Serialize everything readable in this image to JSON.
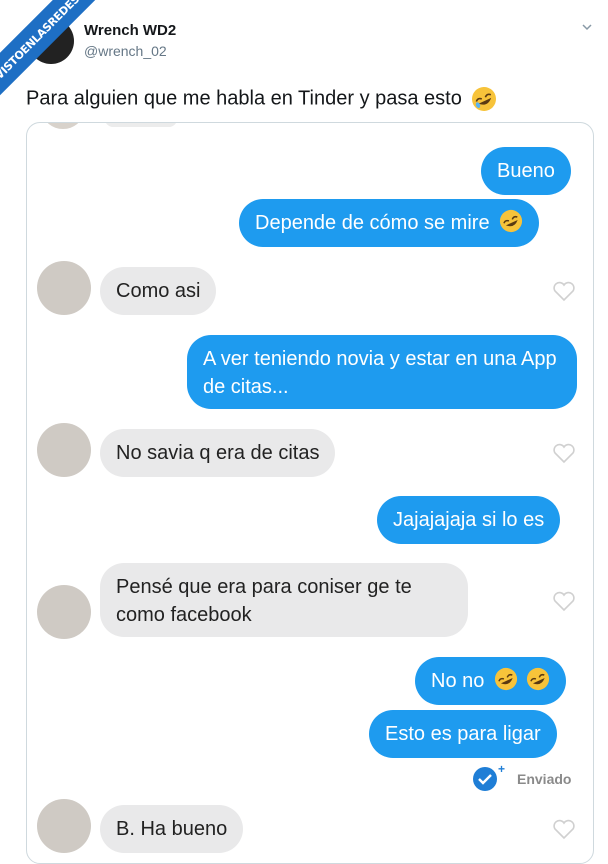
{
  "ribbon": {
    "text": "VISTOENLASREDES"
  },
  "tweet": {
    "name": "Wrench WD2",
    "handle": "@wrench_02",
    "text": "Para alguien que me habla en Tinder y pasa esto"
  },
  "chat": {
    "messages": [
      {
        "dir": "out",
        "text": "Bueno"
      },
      {
        "dir": "out",
        "text": "Depende de cómo se mire"
      },
      {
        "dir": "in",
        "text": "Como asi"
      },
      {
        "dir": "out",
        "text": "A ver teniendo novia y estar en una App de citas..."
      },
      {
        "dir": "in",
        "text": "No savia q era de citas"
      },
      {
        "dir": "out",
        "text": "Jajajajaja si lo es"
      },
      {
        "dir": "in",
        "text": "Pensé que era para coniser ge te como facebook"
      },
      {
        "dir": "out",
        "text": "No no"
      },
      {
        "dir": "out",
        "text": "Esto es para ligar"
      },
      {
        "dir": "in",
        "text": "B. Ha bueno"
      }
    ],
    "status": "Enviado"
  },
  "colors": {
    "out_bubble": "#1e9bef",
    "in_bubble": "#e9e9ea",
    "ribbon": "#1e6fc4"
  }
}
